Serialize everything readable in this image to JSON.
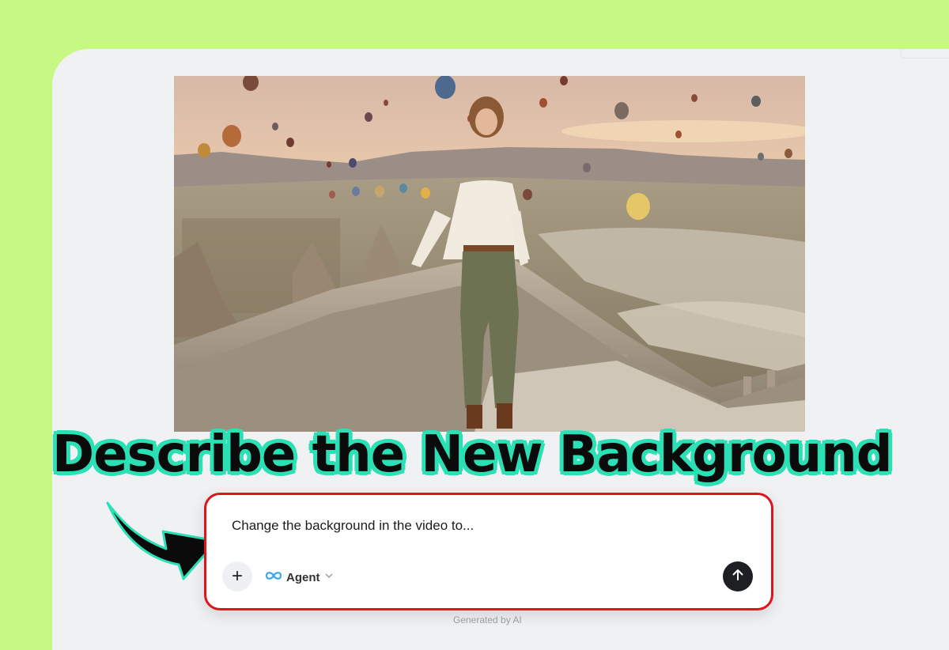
{
  "headline": "Describe the New Background",
  "prompt": {
    "text": "Change the background in the video to...",
    "add_label": "+",
    "agent_label": "Agent",
    "agent_icon": "infinity-icon",
    "dropdown_icon": "chevron-down-icon",
    "send_icon": "arrow-up-icon"
  },
  "footer": {
    "note": "Generated by AI"
  },
  "colors": {
    "background": "#c6f883",
    "panel": "#f0f1f3",
    "headline_outline": "#2ce0b5",
    "prompt_border": "#e0141e",
    "send_button": "#1e1f22",
    "agent_icon": "#3aa8f0"
  }
}
